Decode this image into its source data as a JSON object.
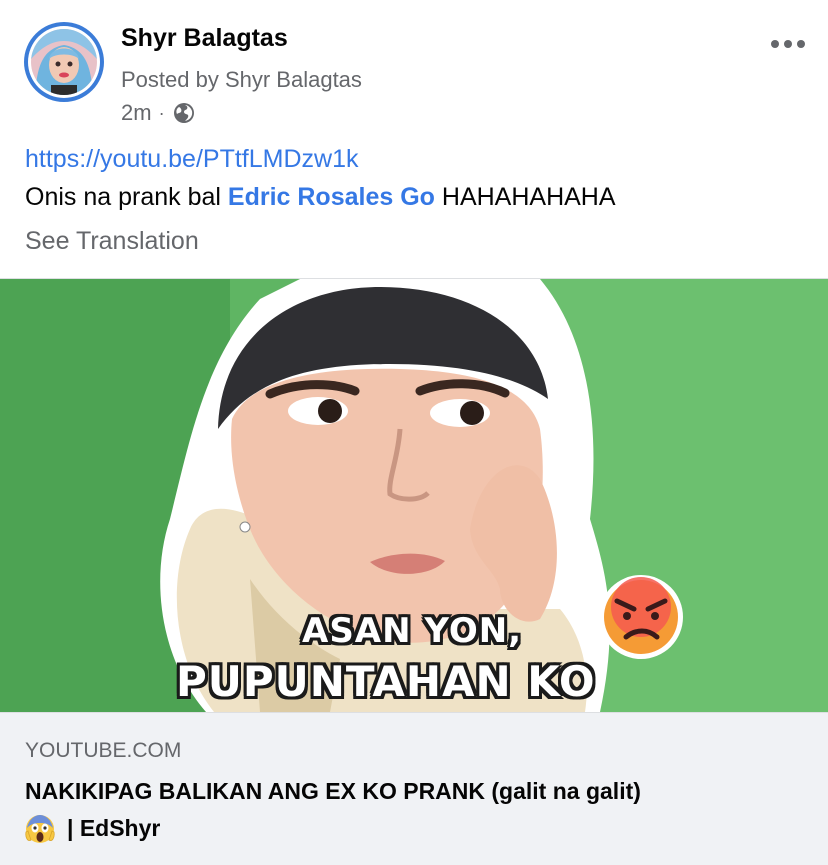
{
  "post": {
    "author_name": "Shyr Balagtas",
    "posted_by": "Posted by Shyr Balagtas",
    "timestamp": "2m",
    "separator": "·",
    "privacy_icon": "globe-icon",
    "more_icon": "more-options-icon",
    "link": "https://youtu.be/PTtfLMDzw1k",
    "caption_prefix": "Onis na prank bal",
    "mention": "Edric Rosales Go",
    "caption_suffix": "HAHAHAHAHA",
    "see_translation": "See Translation"
  },
  "preview": {
    "overlay_line1": "ASAN YON,",
    "overlay_line2": "PUPUNTAHAN KO",
    "domain": "YOUTUBE.COM",
    "title_line1": "NAKIKIPAG BALIKAN ANG EX KO PRANK (galit na galit)",
    "title_line2": "| EdShyr",
    "emoji_icon": "face-screaming-in-fear-icon"
  },
  "colors": {
    "link_blue": "#3578e5",
    "avatar_ring": "#3b7cd8",
    "secondary_text": "#65676b",
    "footer_bg": "#f0f2f5",
    "thumbnail_green": "#5fb563"
  }
}
